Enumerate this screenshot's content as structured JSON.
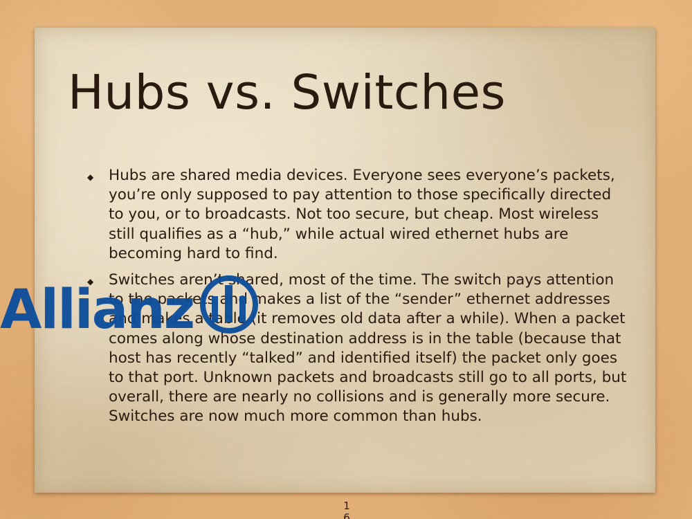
{
  "slide": {
    "title": "Hubs vs. Switches",
    "bullets": [
      {
        "text": "Hubs are shared media devices. Everyone sees everyone’s packets, you’re only supposed to pay attention to those specifically directed to you, or to broadcasts. Not too secure, but cheap. Most wireless still qualifies as a “hub,” while actual wired ethernet hubs are becoming hard to find."
      },
      {
        "text": "Switches aren’t shared, most of the time. The switch pays attention to the packets and makes a list of the “sender” ethernet addresses and makes a table (it removes old data after a while). When a packet comes along whose destination address is in the table (because that host has recently “talked” and identified itself) the packet only goes to that port. Unknown packets and broadcasts still go to all ports, but overall, there are nearly no collisions and is generally more secure. Switches are now much more common than hubs."
      }
    ],
    "bullet_marker": "◆",
    "page_number": "16"
  },
  "logo": {
    "name": "allianz-logo",
    "wordmark": "Allianz",
    "color": "#0f4f9c"
  },
  "colors": {
    "text": "#2b1a10",
    "card": "#e3d5b8",
    "background": "#e0ae76"
  }
}
